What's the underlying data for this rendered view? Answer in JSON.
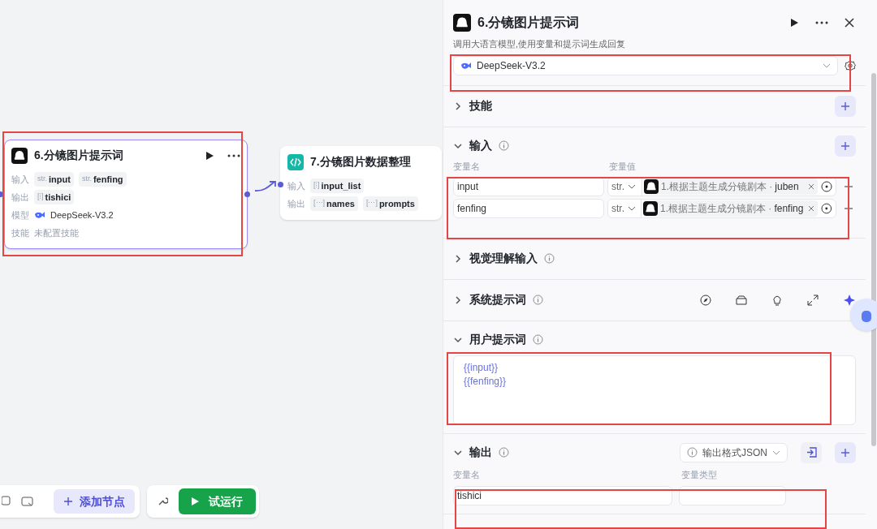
{
  "canvas": {
    "nodes": [
      {
        "kind": "llm",
        "title": "6.分镜图片提示词",
        "selected": true,
        "rows": [
          {
            "label": "输入",
            "tags": [
              {
                "type": "str.",
                "name": "input"
              },
              {
                "type": "str.",
                "name": "fenfing"
              }
            ]
          },
          {
            "label": "输出",
            "tags": [
              {
                "type": "[⁞]",
                "name": "tishici"
              }
            ]
          },
          {
            "label": "模型",
            "model": "DeepSeek-V3.2"
          },
          {
            "label": "技能",
            "note": "未配置技能"
          }
        ]
      },
      {
        "kind": "code",
        "title": "7.分镜图片数据整理",
        "selected": false,
        "rows": [
          {
            "label": "输入",
            "tags": [
              {
                "type": "[⁞]",
                "name": "input_list"
              }
            ]
          },
          {
            "label": "输出",
            "tags": [
              {
                "type": "[⋯]",
                "name": "names"
              },
              {
                "type": "[⋯]",
                "name": "prompts"
              }
            ]
          }
        ]
      }
    ],
    "toolbar": {
      "add_node": "添加节点",
      "test_run": "试运行"
    }
  },
  "panel": {
    "title": "6.分镜图片提示词",
    "description": "调用大语言模型,使用变量和提示词生成回复",
    "model": "DeepSeek-V3.2",
    "sections": [
      {
        "kind": "skills",
        "title": "技能",
        "expanded": false,
        "info": false
      },
      {
        "kind": "inputs",
        "title": "输入",
        "expanded": true,
        "info": true,
        "columns": [
          "变量名",
          "变量值"
        ],
        "rows": [
          {
            "name": "input",
            "type": "str.",
            "source": "1.根据主题生成分镜剧本 ·",
            "field": "juben"
          },
          {
            "name": "fenfing",
            "type": "str.",
            "source": "1.根据主题生成分镜剧本 ·",
            "field": "fenfing"
          }
        ]
      },
      {
        "kind": "vision",
        "title": "视觉理解输入",
        "expanded": false,
        "info": true
      },
      {
        "kind": "system",
        "title": "系统提示词",
        "expanded": false,
        "info": true
      },
      {
        "kind": "user",
        "title": "用户提示词",
        "expanded": true,
        "info": true,
        "lines": [
          "{{input}}",
          "{{fenfing}}"
        ]
      },
      {
        "kind": "output",
        "title": "输出",
        "expanded": true,
        "info": true,
        "format": "输出格式JSON",
        "columns": [
          "变量名",
          "变量类型"
        ],
        "rows": [
          {
            "name": "tishici"
          }
        ]
      }
    ]
  }
}
